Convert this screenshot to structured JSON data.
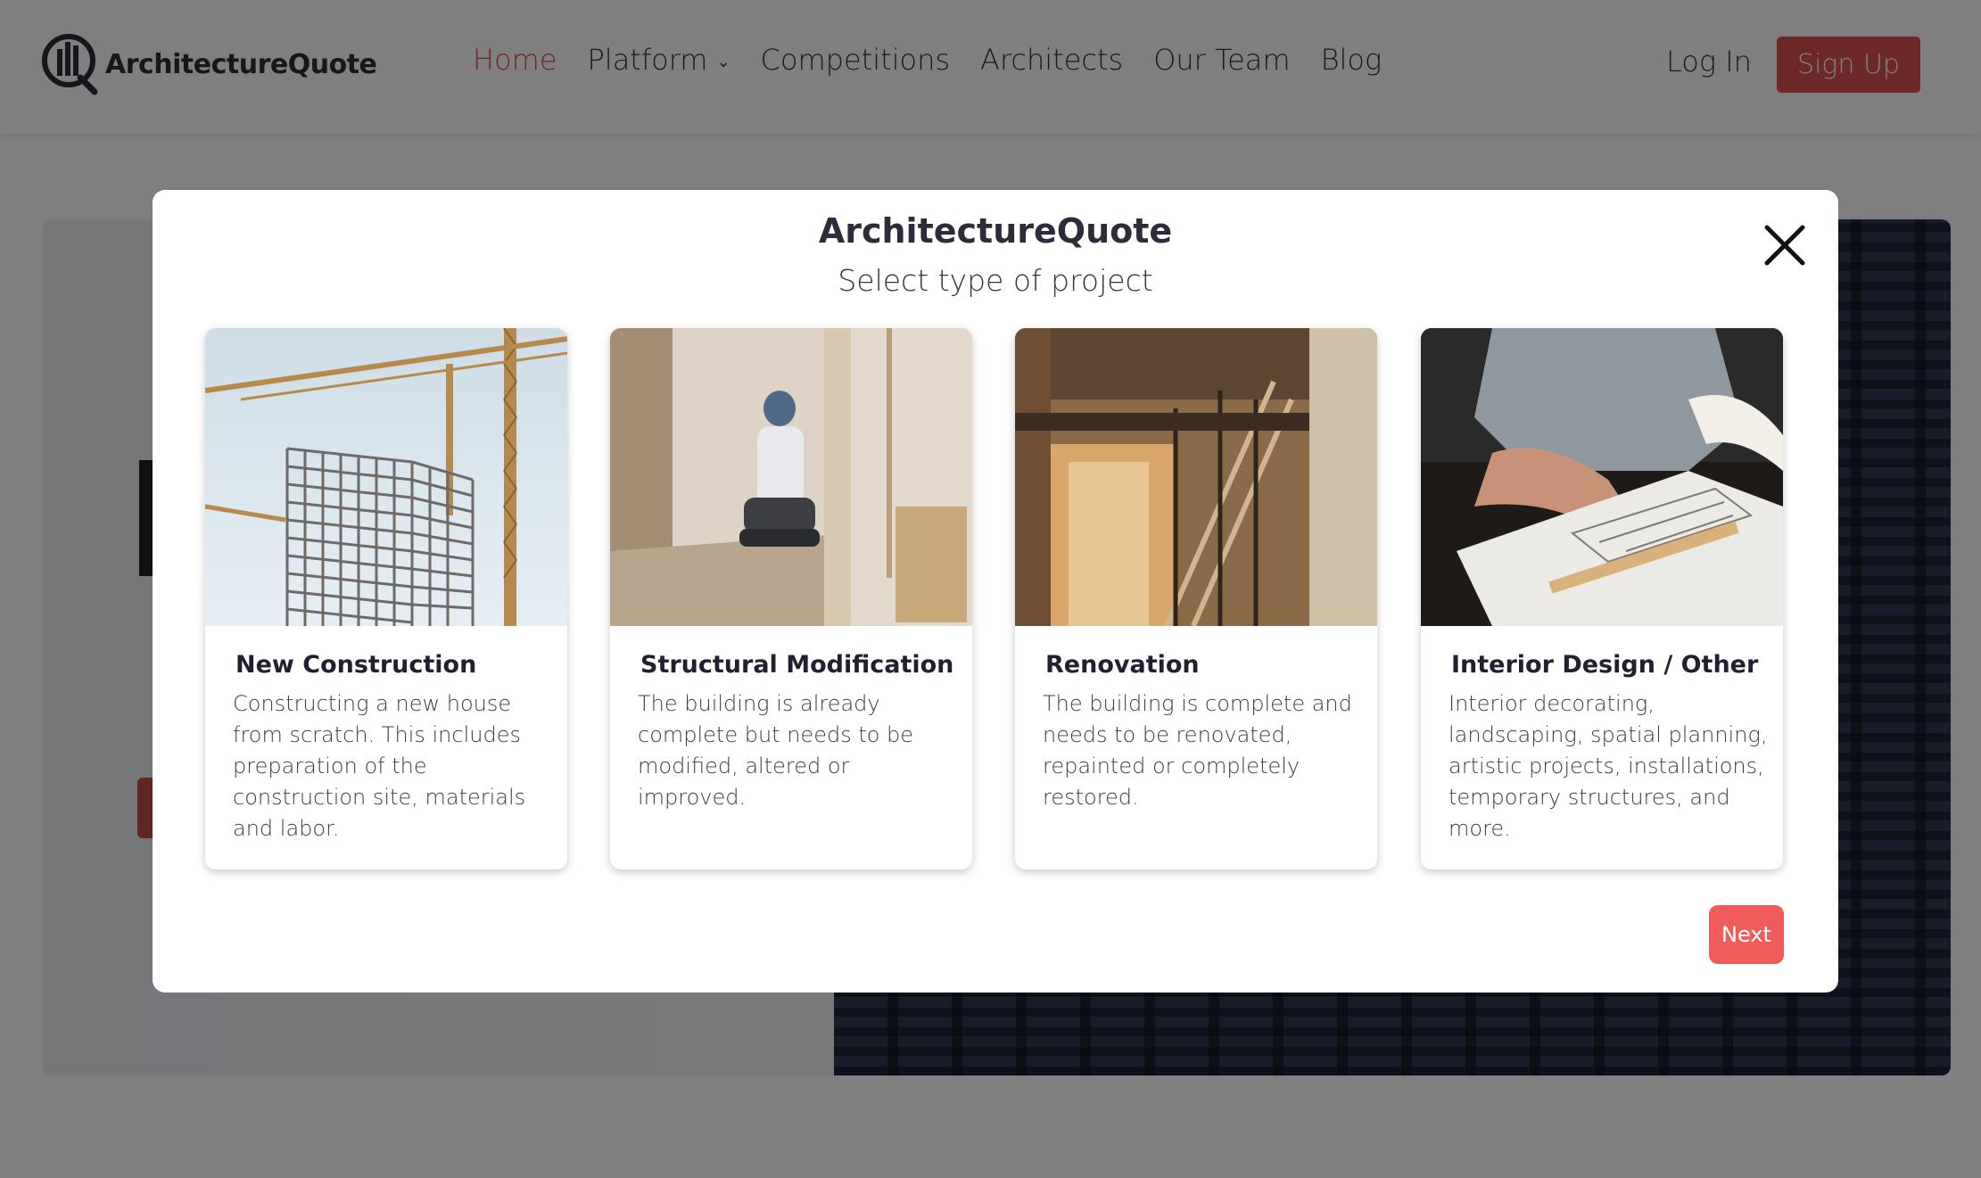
{
  "header": {
    "logo_text": "ArchitectureQuote",
    "nav": [
      {
        "label": "Home",
        "active": true
      },
      {
        "label": "Platform",
        "has_dropdown": true
      },
      {
        "label": "Competitions"
      },
      {
        "label": "Architects"
      },
      {
        "label": "Our Team"
      },
      {
        "label": "Blog"
      }
    ],
    "login_label": "Log In",
    "signup_label": "Sign Up",
    "accent_color": "#d9534f"
  },
  "modal": {
    "title": "ArchitectureQuote",
    "subtitle": "Select type of project",
    "close_icon": "close-icon",
    "cards": [
      {
        "title": "New Construction",
        "description": "Constructing a new house from scratch. This includes preparation of the construction site, materials and labor.",
        "image": "crane-construction-photo"
      },
      {
        "title": "Structural Modification",
        "description": "The building is already complete but needs to be modified, altered or improved.",
        "image": "worker-interior-photo"
      },
      {
        "title": "Renovation",
        "description": "The building is complete and needs to be renovated, repainted or completely restored.",
        "image": "renovation-scaffold-photo"
      },
      {
        "title": "Interior Design / Other",
        "description": "Interior decorating, landscaping, spatial planning, artistic projects, installations, temporary structures, and more.",
        "image": "drafting-blueprint-photo"
      }
    ],
    "next_label": "Next",
    "next_color": "#f05b5b"
  }
}
